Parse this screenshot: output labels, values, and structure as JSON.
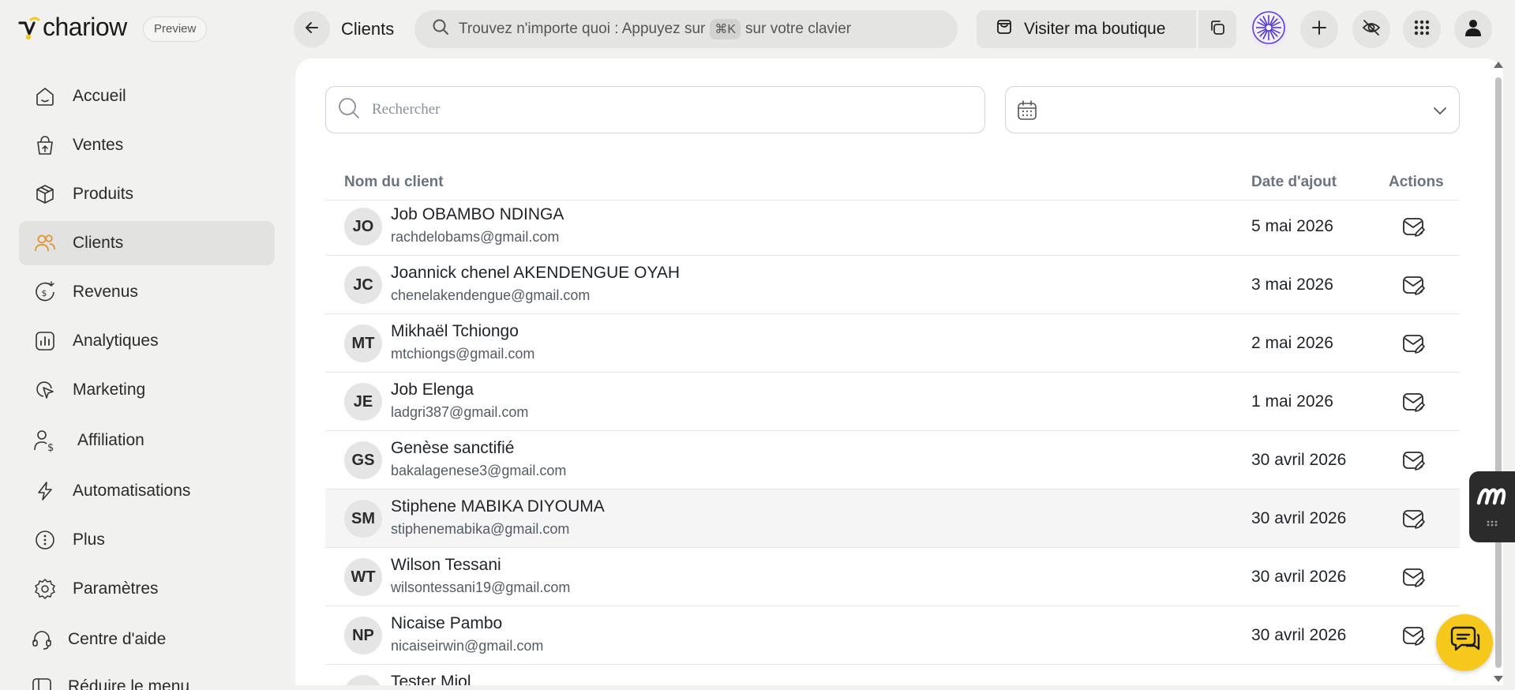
{
  "app": {
    "name": "chariow",
    "badge": "Preview",
    "brand_color": "#f7c81c"
  },
  "header": {
    "page_title": "Clients",
    "search_prefix": "Trouvez n'importe quoi : Appuyez sur",
    "search_kbd": "⌘K",
    "search_suffix": "sur votre clavier",
    "visit_store_label": "Visiter ma boutique"
  },
  "sidebar": {
    "items": [
      {
        "label": "Accueil",
        "icon": "home-icon"
      },
      {
        "label": "Ventes",
        "icon": "shopping-bag-icon"
      },
      {
        "label": "Produits",
        "icon": "box-icon"
      },
      {
        "label": "Clients",
        "icon": "users-icon",
        "active": true
      },
      {
        "label": "Revenus",
        "icon": "revenue-icon"
      },
      {
        "label": "Analytiques",
        "icon": "analytics-icon"
      },
      {
        "label": "Marketing",
        "icon": "marketing-icon"
      },
      {
        "label": "Affiliation",
        "icon": "affiliation-icon"
      },
      {
        "label": "Automatisations",
        "icon": "lightning-icon"
      },
      {
        "label": "Plus",
        "icon": "more-icon"
      },
      {
        "label": "Paramètres",
        "icon": "gear-icon"
      },
      {
        "label": "Centre d'aide",
        "icon": "headset-icon"
      },
      {
        "label": "Réduire le menu",
        "icon": "collapse-icon"
      }
    ]
  },
  "filters": {
    "search_placeholder": "Rechercher"
  },
  "table": {
    "headers": {
      "name": "Nom du client",
      "date": "Date d'ajout",
      "actions": "Actions"
    },
    "rows": [
      {
        "initials": "JO",
        "name": "Job OBAMBO NDINGA",
        "email": "rachdelobams@gmail.com",
        "date": "5 mai 2026"
      },
      {
        "initials": "JC",
        "name": "Joannick chenel AKENDENGUE OYAH",
        "email": "chenelakendengue@gmail.com",
        "date": "3 mai 2026"
      },
      {
        "initials": "MT",
        "name": "Mikhaël Tchiongo",
        "email": "mtchiongs@gmail.com",
        "date": "2 mai 2026"
      },
      {
        "initials": "JE",
        "name": "Job Elenga",
        "email": "ladgri387@gmail.com",
        "date": "1 mai 2026"
      },
      {
        "initials": "GS",
        "name": "Genèse sanctifié",
        "email": "bakalagenese3@gmail.com",
        "date": "30 avril 2026"
      },
      {
        "initials": "SM",
        "name": "Stiphene MABIKA DIYOUMA",
        "email": "stiphenemabika@gmail.com",
        "date": "30 avril 2026",
        "highlighted": true
      },
      {
        "initials": "WT",
        "name": "Wilson Tessani",
        "email": "wilsontessani19@gmail.com",
        "date": "30 avril 2026"
      },
      {
        "initials": "NP",
        "name": "Nicaise Pambo",
        "email": "nicaiseirwin@gmail.com",
        "date": "30 avril 2026"
      },
      {
        "initials": "",
        "name": "Tester Miol",
        "email": "",
        "date": ""
      }
    ]
  }
}
